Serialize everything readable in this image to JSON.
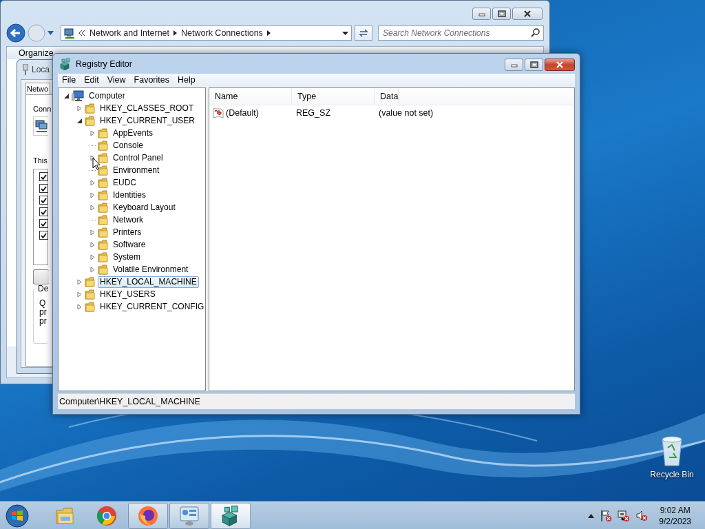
{
  "explorer": {
    "breadcrumb": [
      "Network and Internet",
      "Network Connections"
    ],
    "search_placeholder": "Search Network Connections",
    "toolbar": [
      "Organize"
    ]
  },
  "dialog": {
    "title": "Loca",
    "tab": "Netwo",
    "connect_label": "Conn",
    "items_label": "This",
    "items": [
      {
        "checked": true
      },
      {
        "checked": true
      },
      {
        "checked": true
      },
      {
        "checked": true
      },
      {
        "checked": true
      },
      {
        "checked": true
      }
    ],
    "description_label": "De",
    "description_lines": [
      "Q",
      "pr",
      "pr"
    ]
  },
  "regedit": {
    "title": "Registry Editor",
    "menu": [
      "File",
      "Edit",
      "View",
      "Favorites",
      "Help"
    ],
    "tree": [
      {
        "label": "Computer",
        "expandable": true,
        "expanded": true,
        "selected": false,
        "children": [
          {
            "label": "HKEY_CLASSES_ROOT",
            "expandable": true,
            "expanded": false,
            "selected": false
          },
          {
            "label": "HKEY_CURRENT_USER",
            "expandable": true,
            "expanded": true,
            "selected": false,
            "children": [
              {
                "label": "AppEvents",
                "expandable": true,
                "expanded": false,
                "selected": false
              },
              {
                "label": "Console",
                "expandable": false,
                "expanded": false,
                "selected": false
              },
              {
                "label": "Control Panel",
                "expandable": true,
                "expanded": false,
                "selected": false
              },
              {
                "label": "Environment",
                "expandable": false,
                "expanded": false,
                "selected": false
              },
              {
                "label": "EUDC",
                "expandable": true,
                "expanded": false,
                "selected": false
              },
              {
                "label": "Identities",
                "expandable": true,
                "expanded": false,
                "selected": false
              },
              {
                "label": "Keyboard Layout",
                "expandable": true,
                "expanded": false,
                "selected": false
              },
              {
                "label": "Network",
                "expandable": false,
                "expanded": false,
                "selected": false
              },
              {
                "label": "Printers",
                "expandable": true,
                "expanded": false,
                "selected": false
              },
              {
                "label": "Software",
                "expandable": true,
                "expanded": false,
                "selected": false
              },
              {
                "label": "System",
                "expandable": true,
                "expanded": false,
                "selected": false
              },
              {
                "label": "Volatile Environment",
                "expandable": true,
                "expanded": false,
                "selected": false
              }
            ]
          },
          {
            "label": "HKEY_LOCAL_MACHINE",
            "expandable": true,
            "expanded": false,
            "selected": true
          },
          {
            "label": "HKEY_USERS",
            "expandable": true,
            "expanded": false,
            "selected": false
          },
          {
            "label": "HKEY_CURRENT_CONFIG",
            "expandable": true,
            "expanded": false,
            "selected": false
          }
        ]
      }
    ],
    "columns": [
      "Name",
      "Type",
      "Data"
    ],
    "rows": [
      {
        "name": "(Default)",
        "type": "REG_SZ",
        "data": "(value not set)"
      }
    ],
    "status_bar": "Computer\\HKEY_LOCAL_MACHINE"
  },
  "desktop_icons": [
    {
      "label": "Recycle Bin"
    }
  ],
  "taskbar": {
    "apps": [
      {
        "kind": "explorer",
        "open": false,
        "selected": false
      },
      {
        "kind": "chrome",
        "open": false,
        "selected": false
      },
      {
        "kind": "firefox",
        "open": true,
        "selected": false
      },
      {
        "kind": "control-panel",
        "open": true,
        "selected": false
      },
      {
        "kind": "regedit",
        "open": true,
        "selected": true
      }
    ],
    "time": "9:02 AM",
    "date": "9/2/2023"
  }
}
